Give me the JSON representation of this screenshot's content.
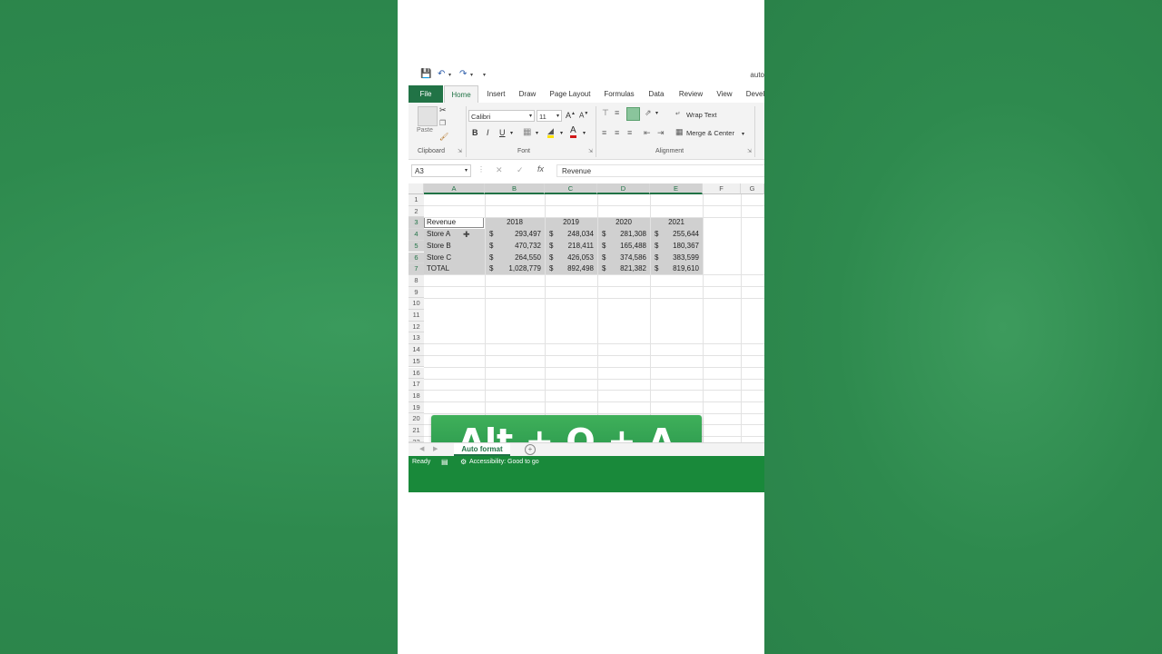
{
  "qat": {
    "title": "auto"
  },
  "tabs": [
    "File",
    "Home",
    "Insert",
    "Draw",
    "Page Layout",
    "Formulas",
    "Data",
    "Review",
    "View",
    "Devel"
  ],
  "ribbon": {
    "paste": "Paste",
    "clipboard": "Clipboard",
    "font_name": "Calibri",
    "font_size": "11",
    "bold": "B",
    "italic": "I",
    "underline": "U",
    "font_label": "Font",
    "wrap_text": "Wrap Text",
    "merge_center": "Merge & Center",
    "alignment": "Alignment"
  },
  "formula_bar": {
    "name_box": "A3",
    "content": "Revenue"
  },
  "columns": [
    "A",
    "B",
    "C",
    "D",
    "E",
    "F",
    "G"
  ],
  "rows": [
    "1",
    "2",
    "3",
    "4",
    "5",
    "6",
    "7",
    "8",
    "9",
    "10",
    "11",
    "12",
    "13",
    "14",
    "15",
    "16",
    "17",
    "18",
    "19",
    "20",
    "21",
    "22"
  ],
  "table": {
    "header": [
      "Revenue",
      "2018",
      "2019",
      "2020",
      "2021"
    ],
    "currency": "$",
    "rows": [
      {
        "label": "Store A",
        "values": [
          "293,497",
          "248,034",
          "281,308",
          "255,644"
        ]
      },
      {
        "label": "Store B",
        "values": [
          "470,732",
          "218,411",
          "165,488",
          "180,367"
        ]
      },
      {
        "label": "Store C",
        "values": [
          "264,550",
          "426,053",
          "374,586",
          "383,599"
        ]
      },
      {
        "label": "TOTAL",
        "values": [
          "1,028,779",
          "892,498",
          "821,382",
          "819,610"
        ]
      }
    ]
  },
  "overlay": {
    "shortcut": "Alt + O + A"
  },
  "sheet": {
    "tab": "Auto format"
  },
  "status": {
    "ready": "Ready",
    "accessibility": "Accessibility: Good to go"
  },
  "colors": {
    "excel_green": "#217346",
    "status_green": "#19893a",
    "background": "#2e8a4e"
  }
}
